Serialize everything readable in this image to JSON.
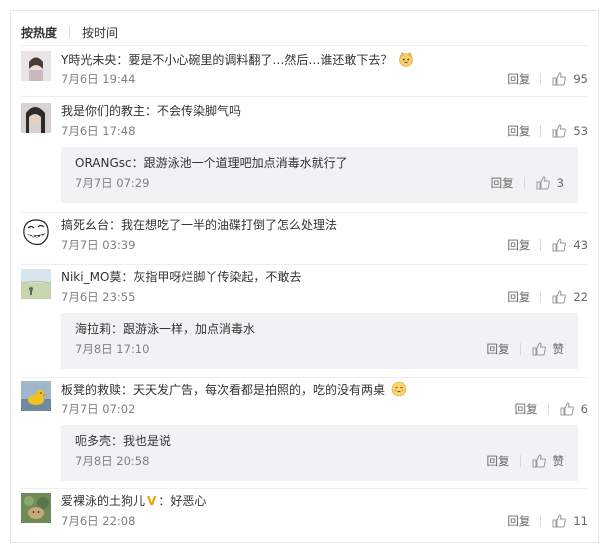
{
  "tabs": {
    "by_hot": "按热度",
    "by_time": "按时间"
  },
  "actions": {
    "reply_label": "回复"
  },
  "comments": [
    {
      "user": "Y時光未央",
      "colon": "：",
      "text": "要是不小心碗里的调料翻了…然后…谁还敢下去？",
      "time": "7月6日 19:44",
      "likes": "95",
      "avatar_icon": "avatar-girl-photo",
      "emoji": "cat-face-emoji"
    },
    {
      "user": "我是你们的教主",
      "colon": "：",
      "text": "不会传染脚气吗",
      "time": "7月6日 17:48",
      "likes": "53",
      "avatar_icon": "avatar-dark-photo",
      "reply": {
        "user": "ORANGsc",
        "colon": "：",
        "text": "跟游泳池一个道理吧加点消毒水就行了",
        "time": "7月7日 07:29",
        "likes": "3"
      }
    },
    {
      "user": "搞死幺台",
      "colon": "：",
      "text": "我在想吃了一半的油碟打倒了怎么处理法",
      "time": "7月7日 03:39",
      "likes": "43",
      "avatar_icon": "avatar-trollface"
    },
    {
      "user": "Niki_MO莫",
      "colon": "：",
      "text": "灰指甲呀烂脚丫传染起，不敢去",
      "time": "7月6日 23:55",
      "likes": "22",
      "avatar_icon": "avatar-beach-photo",
      "reply": {
        "user": "海拉莉",
        "colon": "：",
        "text": "跟游泳一样，加点消毒水",
        "time": "7月8日 17:10",
        "likes": "赞"
      }
    },
    {
      "user": "板凳的救赎",
      "colon": "：",
      "text": "天天发广告，每次看都是拍照的，吃的没有两桌",
      "time": "7月7日 07:02",
      "likes": "6",
      "avatar_icon": "avatar-duck-photo",
      "emoji": "embarrassed-face-emoji",
      "reply": {
        "user": "呃多壳",
        "colon": "：",
        "text": "我也是说",
        "time": "7月8日 20:58",
        "likes": "赞"
      }
    },
    {
      "user": "爱裸泳的土狗儿",
      "colon": "：",
      "text": "好恶心",
      "time": "7月6日 22:08",
      "likes": "11",
      "avatar_icon": "avatar-dog-photo",
      "badge": "V"
    }
  ],
  "colors": {
    "text": "#333333",
    "meta": "#808080",
    "reply_bg": "#f2f2f5",
    "divider": "#eeeeee",
    "badge": "#f0a000"
  }
}
